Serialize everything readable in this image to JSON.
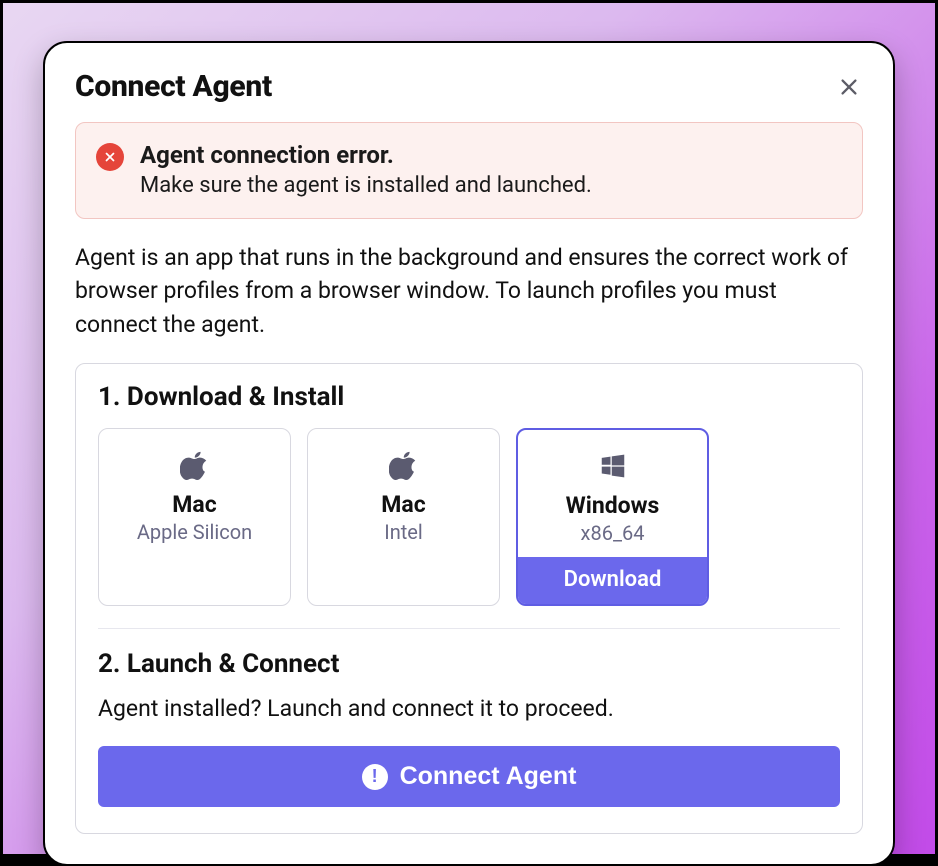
{
  "modal": {
    "title": "Connect Agent"
  },
  "alert": {
    "title": "Agent connection error.",
    "subtitle": "Make sure the agent is installed and launched."
  },
  "description": "Agent is an app that runs in the background and ensures the correct work of browser profiles from a browser window. To launch profiles you must connect the agent.",
  "step1": {
    "title": "1. Download & Install",
    "options": [
      {
        "os": "Mac",
        "arch": "Apple Silicon",
        "selected": false
      },
      {
        "os": "Mac",
        "arch": "Intel",
        "selected": false
      },
      {
        "os": "Windows",
        "arch": "x86_64",
        "selected": true
      }
    ],
    "download_label": "Download"
  },
  "step2": {
    "title": "2. Launch & Connect",
    "subtitle": "Agent installed? Launch and connect it to proceed.",
    "button_label": "Connect Agent"
  }
}
